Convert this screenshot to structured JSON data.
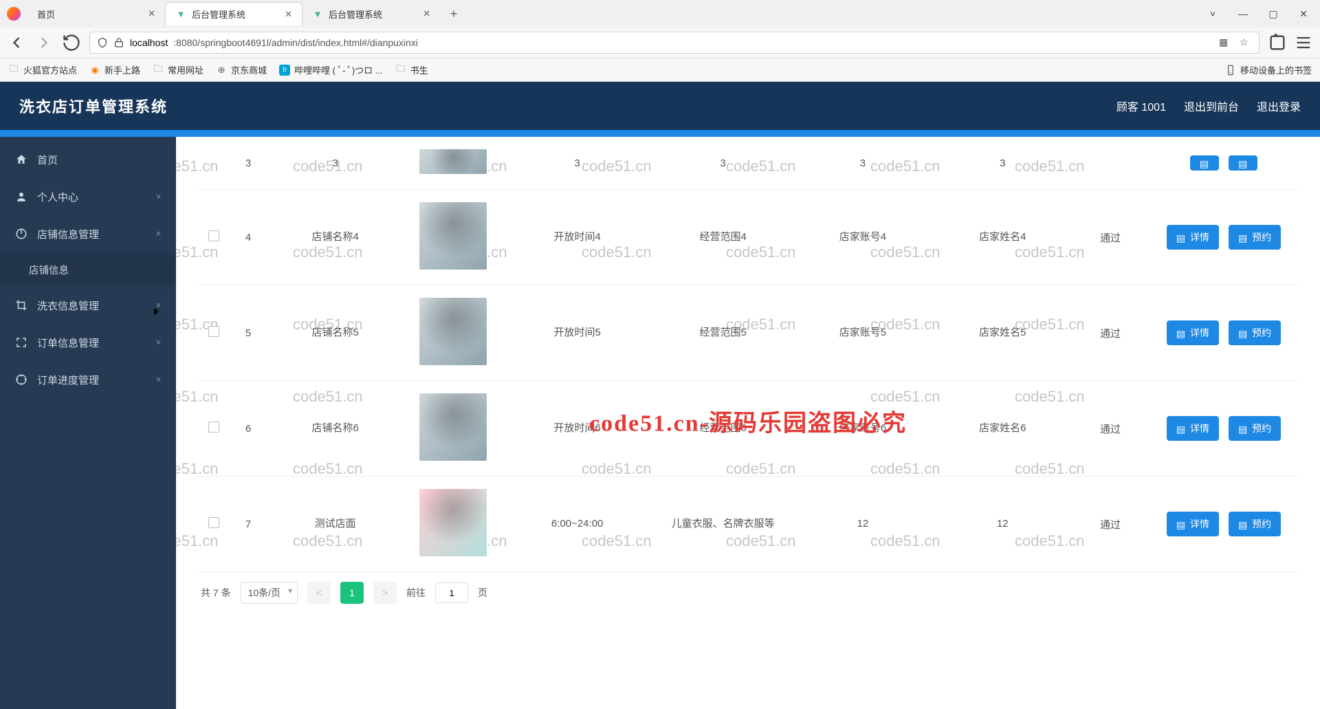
{
  "browser": {
    "tabs": [
      {
        "label": "首页",
        "active": false,
        "icon": ""
      },
      {
        "label": "后台管理系统",
        "active": true,
        "icon": "vue"
      },
      {
        "label": "后台管理系统",
        "active": false,
        "icon": "vue"
      }
    ],
    "url_host": "localhost",
    "url_path": ":8080/springboot4691l/admin/dist/index.html#/dianpuxinxi",
    "bookmarks": [
      "火狐官方站点",
      "新手上路",
      "常用网址",
      "京东商城",
      "哔哩哔哩 (  ﾟ- ﾟ)つロ ...",
      "书生"
    ],
    "mobile_bookmark": "移动设备上的书签"
  },
  "header": {
    "title": "洗衣店订单管理系统",
    "user": "顾客 1001",
    "to_front": "退出到前台",
    "logout": "退出登录"
  },
  "sidebar": {
    "items": [
      {
        "label": "首页",
        "icon": "home",
        "expandable": false
      },
      {
        "label": "个人中心",
        "icon": "user",
        "expandable": true,
        "expanded": false
      },
      {
        "label": "店铺信息管理",
        "icon": "power",
        "expandable": true,
        "expanded": true,
        "children": [
          {
            "label": "店铺信息"
          }
        ]
      },
      {
        "label": "洗衣信息管理",
        "icon": "crop",
        "expandable": true,
        "expanded": false
      },
      {
        "label": "订单信息管理",
        "icon": "fullscreen",
        "expandable": true,
        "expanded": false
      },
      {
        "label": "订单进度管理",
        "icon": "target",
        "expandable": true,
        "expanded": false
      }
    ]
  },
  "table": {
    "rows_partial_first": {
      "index": "3",
      "c0": "3",
      "c3": "3",
      "c4": "3",
      "c5": "3",
      "c6": "3"
    },
    "rows": [
      {
        "index": "4",
        "shop_name": "店铺名称4",
        "open_time": "开放时间4",
        "scope": "经营范围4",
        "merchant_acct": "店家账号4",
        "merchant_name": "店家姓名4",
        "status": "通过"
      },
      {
        "index": "5",
        "shop_name": "店铺名称5",
        "open_time": "开放时间5",
        "scope": "经营范围5",
        "merchant_acct": "店家账号5",
        "merchant_name": "店家姓名5",
        "status": "通过"
      },
      {
        "index": "6",
        "shop_name": "店铺名称6",
        "open_time": "开放时间6",
        "scope": "经营范围6",
        "merchant_acct": "店家账号6",
        "merchant_name": "店家姓名6",
        "status": "通过"
      },
      {
        "index": "7",
        "shop_name": "测试店面",
        "open_time": "6:00~24:00",
        "scope": "儿童衣服、名牌衣服等",
        "merchant_acct": "12",
        "merchant_name": "12",
        "status": "通过"
      }
    ],
    "btn_detail": "详情",
    "btn_reserve": "预约"
  },
  "pager": {
    "total": "共 7 条",
    "page_size": "10条/页",
    "current": "1",
    "goto_prefix": "前往",
    "goto_value": "1",
    "goto_suffix": "页"
  },
  "watermark": {
    "text": "code51.cn",
    "red_text": "code51.cn-源码乐园盗图必究"
  }
}
